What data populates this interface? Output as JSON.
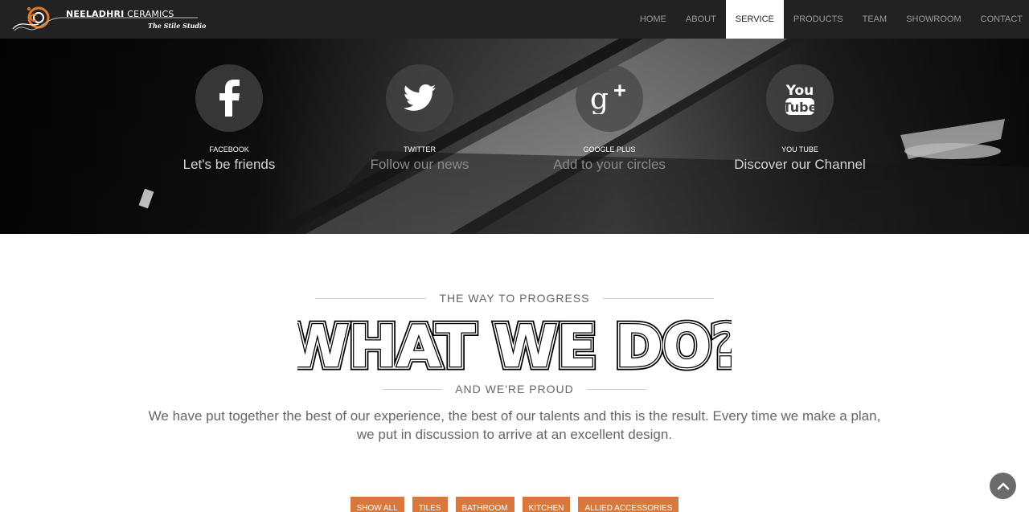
{
  "brand": {
    "name_bold": "NEELADHRI",
    "name_rest": " CERAMICS",
    "tagline": "The Stile Studio"
  },
  "nav": {
    "items": [
      {
        "label": "HOME",
        "active": false
      },
      {
        "label": "ABOUT",
        "active": false
      },
      {
        "label": "SERVICE",
        "active": true
      },
      {
        "label": "PRODUCTS",
        "active": false
      },
      {
        "label": "TEAM",
        "active": false
      },
      {
        "label": "SHOWROOM",
        "active": false
      },
      {
        "label": "CONTACT",
        "active": false
      }
    ]
  },
  "social": [
    {
      "icon": "facebook-icon",
      "name": "FACEBOOK",
      "tag": "Let's be friends"
    },
    {
      "icon": "twitter-icon",
      "name": "TWITTER",
      "tag": "Follow our news"
    },
    {
      "icon": "google-plus-icon",
      "name": "GOOGLE PLUS",
      "tag": "Add to your circles"
    },
    {
      "icon": "youtube-icon",
      "name": "YOU TUBE",
      "tag": "Discover our Channel"
    }
  ],
  "services": {
    "kicker": "THE WAY TO PROGRESS",
    "title": "WHAT WE DO?",
    "subkicker": "AND WE'RE PROUD",
    "intro": "We have put together the best of our experience, the best of our talents and this is the result. Every time we make a plan, we put in discussion to arrive at an excellent design.",
    "filters": [
      "SHOW ALL",
      "TILES",
      "BATHROOM",
      "KITCHEN",
      "ALLIED ACCESSORIES"
    ]
  },
  "colors": {
    "navbar": "#222222",
    "accent": "#d9783a",
    "text_muted": "#666666"
  }
}
